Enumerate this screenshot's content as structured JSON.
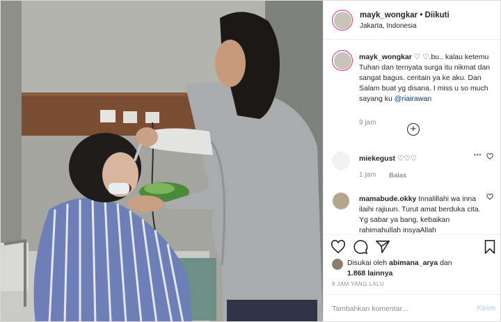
{
  "post": {
    "username": "mayk_wongkar",
    "follow_status": "• Diikuti",
    "location": "Jakarta, Indonesia",
    "more_icon": "more-horizontal-icon"
  },
  "caption": {
    "username": "mayk_wongkar",
    "text": " ♡ ♡.bu.. kalau ketemu Tuhan dan ternyata surga itu nikmat dan sangat bagus. ceritain ya ke aku. Dan Salam buat yg disana. I miss u so much sayang ku ",
    "mention": "@riairawan",
    "time": "9 jam",
    "expand_icon": "plus-circle-icon"
  },
  "comments": [
    {
      "username": "miekegust",
      "text": " ♡♡♡",
      "time": "1 jam",
      "reply_label": "Balas"
    },
    {
      "username": "mamabude.okky",
      "text": " Innalillahi wa inna ilaihi rajiuun. Turut amat berduka cita. Yg sabar ya bang, kebaikan rahimahullah insyaAllah"
    }
  ],
  "actions": {
    "like_icon": "heart-icon",
    "comment_icon": "comment-icon",
    "share_icon": "paper-plane-icon",
    "save_icon": "bookmark-icon"
  },
  "likes": {
    "prefix": "Disukai oleh ",
    "user": "abimana_arya",
    "middle": " dan ",
    "others": "1.868 lainnya"
  },
  "timestamp": "9 JAM YANG LALU",
  "add_comment": {
    "placeholder": "Tambahkan komentar...",
    "post_label": "Kirim"
  },
  "colors": {
    "link": "#003569",
    "muted": "#8e8e8e",
    "post_disabled": "#b2dffc",
    "story_ring": "#d6249f"
  }
}
